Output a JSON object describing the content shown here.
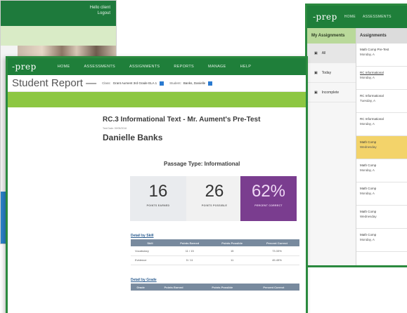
{
  "left_window": {
    "greeting": "Hello client",
    "logout": "Logout"
  },
  "right_window": {
    "logo": "-prep",
    "nav": [
      "HOME",
      "ASSESSMENTS"
    ],
    "sidebar_title": "My Assignments",
    "sidebar_items": [
      "All",
      "Today",
      "Incomplete"
    ],
    "main_title": "Assignments",
    "rows": [
      {
        "title": "Math Comp Pre-Test",
        "date": "Monday, A",
        "highlight": false
      },
      {
        "title": "RC Informational",
        "date": "Monday, A",
        "highlight": false
      },
      {
        "title": "RC Informational",
        "date": "Tuesday, A",
        "highlight": false
      },
      {
        "title": "RC Informational",
        "date": "Monday, A",
        "highlight": false
      },
      {
        "title": "Math Comp",
        "date": "Wednesday",
        "highlight": true
      },
      {
        "title": "Math Comp",
        "date": "Monday, A",
        "highlight": false
      },
      {
        "title": "Math Comp",
        "date": "Monday, A",
        "highlight": false
      },
      {
        "title": "Math Comp",
        "date": "Wednesday",
        "highlight": false
      },
      {
        "title": "Math Comp",
        "date": "Monday, A",
        "highlight": false
      }
    ]
  },
  "main_window": {
    "logo": "-prep",
    "nav": [
      "HOME",
      "ASSESSMENTS",
      "ASSIGNMENTS",
      "REPORTS",
      "MANAGE",
      "HELP"
    ],
    "report_title": "Student Report —",
    "class_label": "Class:",
    "class_value": "Grant Aument 3rd Grade ELA 1",
    "student_label": "Student:",
    "student_value": "Banks, Danielle",
    "test_title": "RC.3 Informational Text - Mr. Aument's Pre-Test",
    "test_date": "Test Date: 09/05/2016",
    "student_name": "Danielle Banks",
    "passage_type": "Passage Type: Informational",
    "stats": {
      "earned": {
        "value": "16",
        "label": "POINTS EARNED"
      },
      "possible": {
        "value": "26",
        "label": "POINTS POSSIBLE"
      },
      "pct": {
        "value": "62%",
        "label": "PERCENT CORRECT"
      }
    },
    "detail_skill": {
      "title": "Detail by Skill",
      "headers": [
        "Skill",
        "Points Earned",
        "Points Possible",
        "Percent Correct"
      ],
      "rows": [
        [
          "Vocabulary",
          "11 / 15",
          "15",
          "73.33%"
        ],
        [
          "Evidence",
          "5 / 11",
          "11",
          "45.45%"
        ]
      ]
    },
    "detail_grade": {
      "title": "Detail by Grade",
      "headers": [
        "Grade",
        "Points Earned",
        "Points Possible",
        "Percent Correct"
      ]
    }
  },
  "colors": {
    "nav_green": "#1f7f3a",
    "band_green": "#8dc742",
    "percent_purple": "#7a3d8f",
    "highlight_yellow": "#f3d36a",
    "table_header": "#788a9e"
  }
}
